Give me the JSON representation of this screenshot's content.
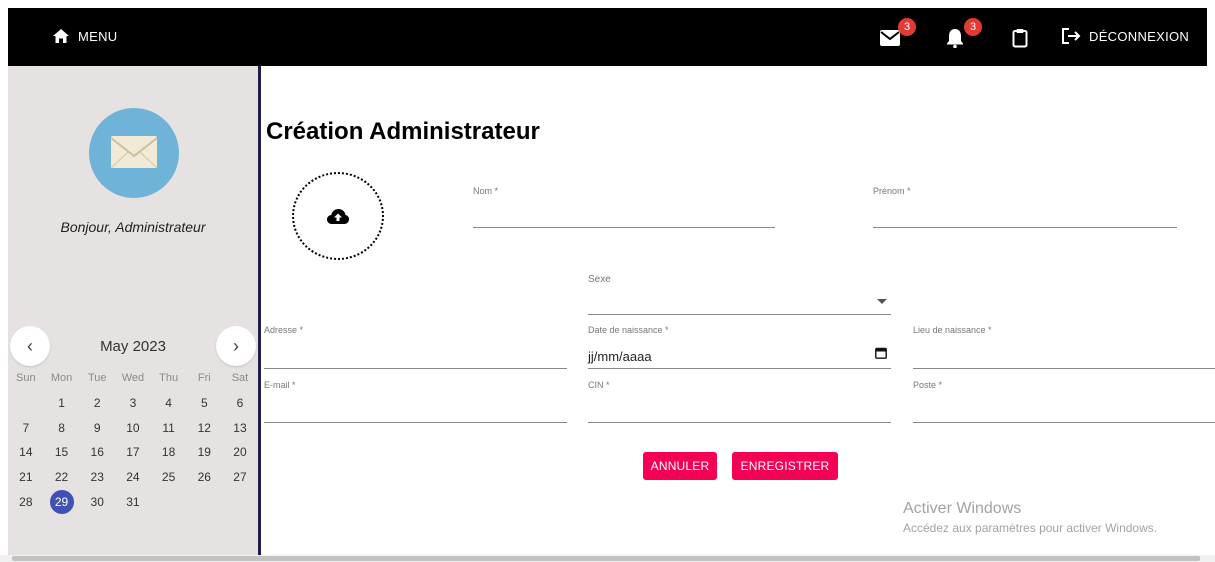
{
  "topbar": {
    "menu_label": "MENU",
    "mail_badge": "3",
    "bell_badge": "3",
    "logout_label": "DÉCONNEXION"
  },
  "sidebar": {
    "greeting": "Bonjour, Administrateur",
    "calendar": {
      "title": "May 2023",
      "weekdays": [
        "Sun",
        "Mon",
        "Tue",
        "Wed",
        "Thu",
        "Fri",
        "Sat"
      ],
      "selected_day": "29",
      "days": [
        "",
        "1",
        "2",
        "3",
        "4",
        "5",
        "6",
        "7",
        "8",
        "9",
        "10",
        "11",
        "12",
        "13",
        "14",
        "15",
        "16",
        "17",
        "18",
        "19",
        "20",
        "21",
        "22",
        "23",
        "24",
        "25",
        "26",
        "27",
        "28",
        "29",
        "30",
        "31"
      ]
    }
  },
  "form": {
    "title": "Création Administrateur",
    "nom_label": "Nom *",
    "prenom_label": "Prénom *",
    "sexe_label": "Sexe",
    "adresse_label": "Adresse *",
    "date_label": "Date de naissance *",
    "date_value": "jj/mm/aaaa",
    "lieu_label": "Lieu de naissance *",
    "email_label": "E-mail *",
    "cin_label": "CIN *",
    "poste_label": "Poste *",
    "cancel_label": "ANNULER",
    "save_label": "ENREGISTRER"
  },
  "watermark": {
    "line1": "Activer Windows",
    "line2": "Accédez aux paramètres pour activer Windows."
  },
  "colors": {
    "accent": "#f50057",
    "calendar_selected": "#3f51b5",
    "badge": "#e53935"
  }
}
